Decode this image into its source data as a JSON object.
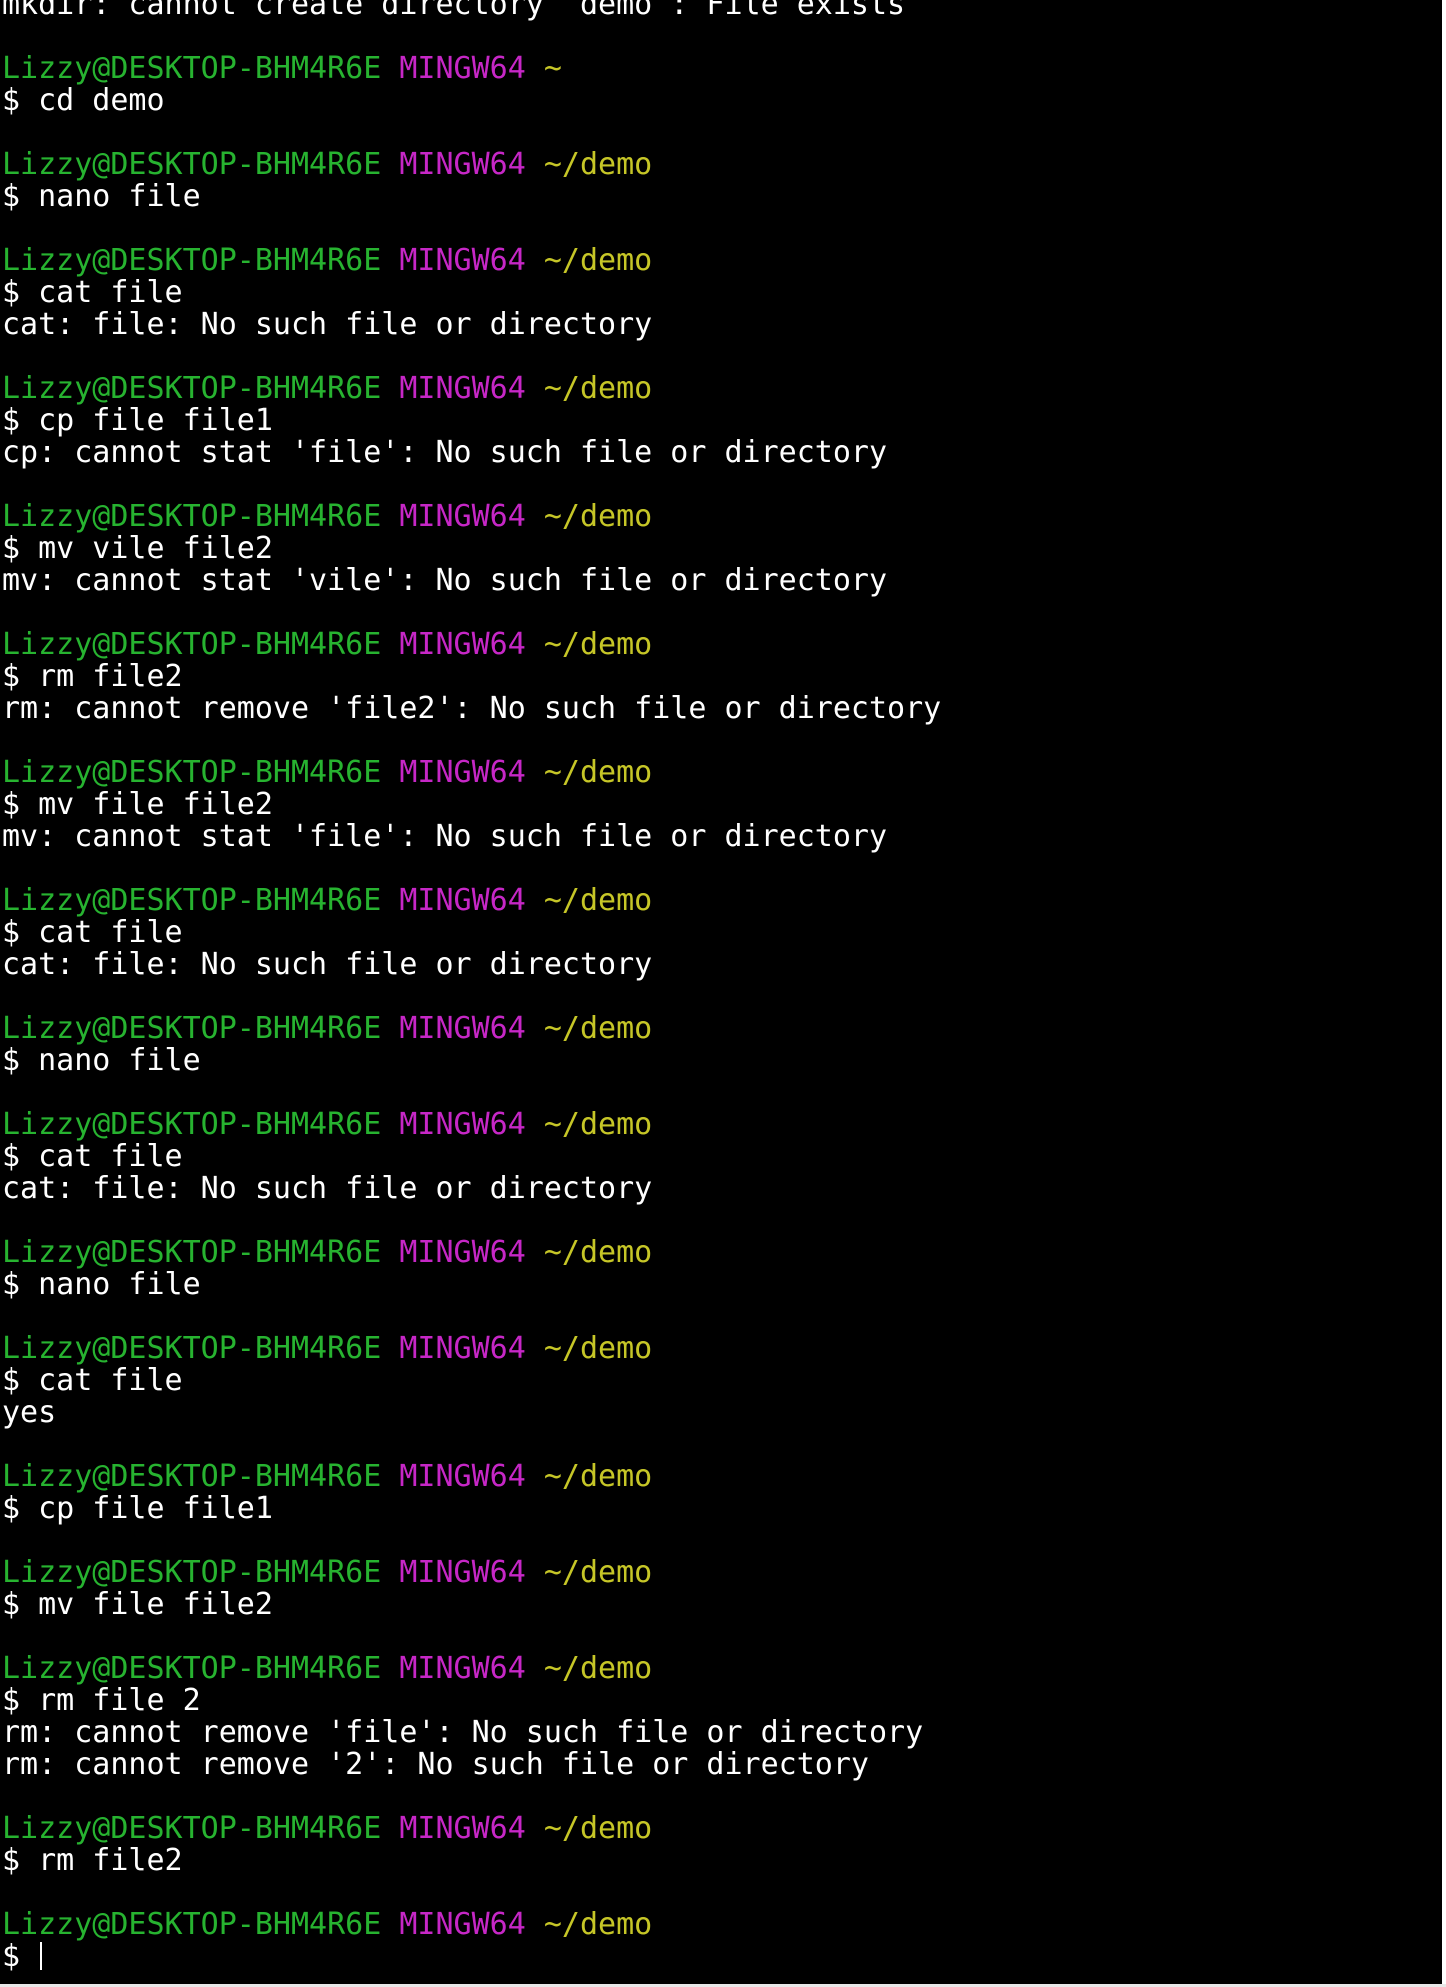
{
  "terminal": {
    "colors": {
      "background": "#000000",
      "text": "#ffffff",
      "user_host": "#27b330",
      "system": "#c627c6",
      "path": "#c6c627"
    },
    "lines": [
      {
        "type": "output",
        "text": "mkdir: cannot create directory ‘demo’: File exists"
      },
      {
        "type": "blank"
      },
      {
        "type": "prompt",
        "user": "Lizzy@DESKTOP-BHM4R6E",
        "system": "MINGW64",
        "path": "~"
      },
      {
        "type": "command",
        "text": "$ cd demo"
      },
      {
        "type": "blank"
      },
      {
        "type": "prompt",
        "user": "Lizzy@DESKTOP-BHM4R6E",
        "system": "MINGW64",
        "path": "~/demo"
      },
      {
        "type": "command",
        "text": "$ nano file"
      },
      {
        "type": "blank"
      },
      {
        "type": "prompt",
        "user": "Lizzy@DESKTOP-BHM4R6E",
        "system": "MINGW64",
        "path": "~/demo"
      },
      {
        "type": "command",
        "text": "$ cat file"
      },
      {
        "type": "output",
        "text": "cat: file: No such file or directory"
      },
      {
        "type": "blank"
      },
      {
        "type": "prompt",
        "user": "Lizzy@DESKTOP-BHM4R6E",
        "system": "MINGW64",
        "path": "~/demo"
      },
      {
        "type": "command",
        "text": "$ cp file file1"
      },
      {
        "type": "output",
        "text": "cp: cannot stat 'file': No such file or directory"
      },
      {
        "type": "blank"
      },
      {
        "type": "prompt",
        "user": "Lizzy@DESKTOP-BHM4R6E",
        "system": "MINGW64",
        "path": "~/demo"
      },
      {
        "type": "command",
        "text": "$ mv vile file2"
      },
      {
        "type": "output",
        "text": "mv: cannot stat 'vile': No such file or directory"
      },
      {
        "type": "blank"
      },
      {
        "type": "prompt",
        "user": "Lizzy@DESKTOP-BHM4R6E",
        "system": "MINGW64",
        "path": "~/demo"
      },
      {
        "type": "command",
        "text": "$ rm file2"
      },
      {
        "type": "output",
        "text": "rm: cannot remove 'file2': No such file or directory"
      },
      {
        "type": "blank"
      },
      {
        "type": "prompt",
        "user": "Lizzy@DESKTOP-BHM4R6E",
        "system": "MINGW64",
        "path": "~/demo"
      },
      {
        "type": "command",
        "text": "$ mv file file2"
      },
      {
        "type": "output",
        "text": "mv: cannot stat 'file': No such file or directory"
      },
      {
        "type": "blank"
      },
      {
        "type": "prompt",
        "user": "Lizzy@DESKTOP-BHM4R6E",
        "system": "MINGW64",
        "path": "~/demo"
      },
      {
        "type": "command",
        "text": "$ cat file"
      },
      {
        "type": "output",
        "text": "cat: file: No such file or directory"
      },
      {
        "type": "blank"
      },
      {
        "type": "prompt",
        "user": "Lizzy@DESKTOP-BHM4R6E",
        "system": "MINGW64",
        "path": "~/demo"
      },
      {
        "type": "command",
        "text": "$ nano file"
      },
      {
        "type": "blank"
      },
      {
        "type": "prompt",
        "user": "Lizzy@DESKTOP-BHM4R6E",
        "system": "MINGW64",
        "path": "~/demo"
      },
      {
        "type": "command",
        "text": "$ cat file"
      },
      {
        "type": "output",
        "text": "cat: file: No such file or directory"
      },
      {
        "type": "blank"
      },
      {
        "type": "prompt",
        "user": "Lizzy@DESKTOP-BHM4R6E",
        "system": "MINGW64",
        "path": "~/demo"
      },
      {
        "type": "command",
        "text": "$ nano file"
      },
      {
        "type": "blank"
      },
      {
        "type": "prompt",
        "user": "Lizzy@DESKTOP-BHM4R6E",
        "system": "MINGW64",
        "path": "~/demo"
      },
      {
        "type": "command",
        "text": "$ cat file"
      },
      {
        "type": "output",
        "text": "yes"
      },
      {
        "type": "blank"
      },
      {
        "type": "prompt",
        "user": "Lizzy@DESKTOP-BHM4R6E",
        "system": "MINGW64",
        "path": "~/demo"
      },
      {
        "type": "command",
        "text": "$ cp file file1"
      },
      {
        "type": "blank"
      },
      {
        "type": "prompt",
        "user": "Lizzy@DESKTOP-BHM4R6E",
        "system": "MINGW64",
        "path": "~/demo"
      },
      {
        "type": "command",
        "text": "$ mv file file2"
      },
      {
        "type": "blank"
      },
      {
        "type": "prompt",
        "user": "Lizzy@DESKTOP-BHM4R6E",
        "system": "MINGW64",
        "path": "~/demo"
      },
      {
        "type": "command",
        "text": "$ rm file 2"
      },
      {
        "type": "output",
        "text": "rm: cannot remove 'file': No such file or directory"
      },
      {
        "type": "output",
        "text": "rm: cannot remove '2': No such file or directory"
      },
      {
        "type": "blank"
      },
      {
        "type": "prompt",
        "user": "Lizzy@DESKTOP-BHM4R6E",
        "system": "MINGW64",
        "path": "~/demo"
      },
      {
        "type": "command",
        "text": "$ rm file2"
      },
      {
        "type": "blank"
      },
      {
        "type": "prompt",
        "user": "Lizzy@DESKTOP-BHM4R6E",
        "system": "MINGW64",
        "path": "~/demo"
      },
      {
        "type": "input",
        "text": "$ "
      }
    ]
  }
}
